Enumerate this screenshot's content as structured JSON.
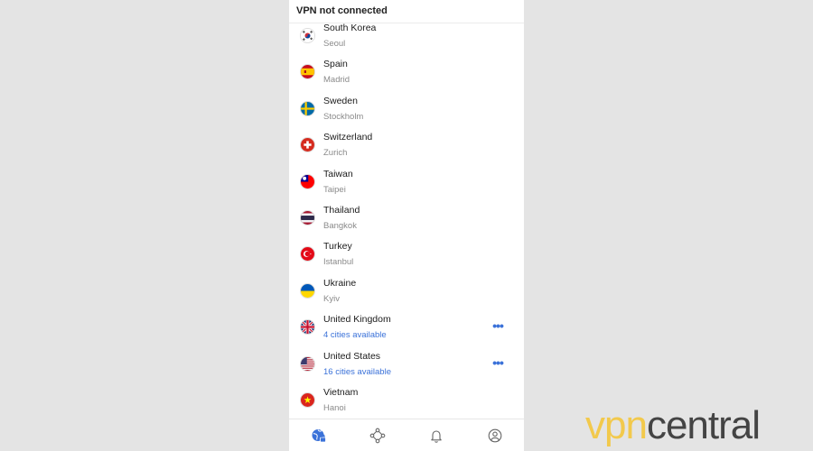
{
  "header": {
    "title": "VPN not connected"
  },
  "servers": [
    {
      "country": "South Korea",
      "city": "Seoul",
      "flag": "flag-south-korea"
    },
    {
      "country": "Spain",
      "city": "Madrid",
      "flag": "flag-spain"
    },
    {
      "country": "Sweden",
      "city": "Stockholm",
      "flag": "flag-sweden"
    },
    {
      "country": "Switzerland",
      "city": "Zurich",
      "flag": "flag-switzerland"
    },
    {
      "country": "Taiwan",
      "city": "Taipei",
      "flag": "flag-taiwan"
    },
    {
      "country": "Thailand",
      "city": "Bangkok",
      "flag": "flag-thailand"
    },
    {
      "country": "Turkey",
      "city": "Istanbul",
      "flag": "flag-turkey"
    },
    {
      "country": "Ukraine",
      "city": "Kyiv",
      "flag": "flag-ukraine"
    },
    {
      "country": "United Kingdom",
      "city": "4 cities available",
      "flag": "flag-united-kingdom"
    },
    {
      "country": "United States",
      "city": "16 cities available",
      "flag": "flag-united-states"
    },
    {
      "country": "Vietnam",
      "city": "Hanoi",
      "flag": "flag-vietnam"
    }
  ],
  "more_label": "•••",
  "bottom_nav": [
    {
      "icon": "globe-lock-icon",
      "active": true
    },
    {
      "icon": "network-nodes-icon",
      "active": false
    },
    {
      "icon": "bell-icon",
      "active": false
    },
    {
      "icon": "profile-icon",
      "active": false
    }
  ],
  "watermark": {
    "vpn": "vpn",
    "central": "central"
  },
  "colors": {
    "accent": "#3b72d9",
    "background": "#e4e4e4",
    "logo_yellow": "#f2c94c",
    "logo_gray": "#444444"
  }
}
